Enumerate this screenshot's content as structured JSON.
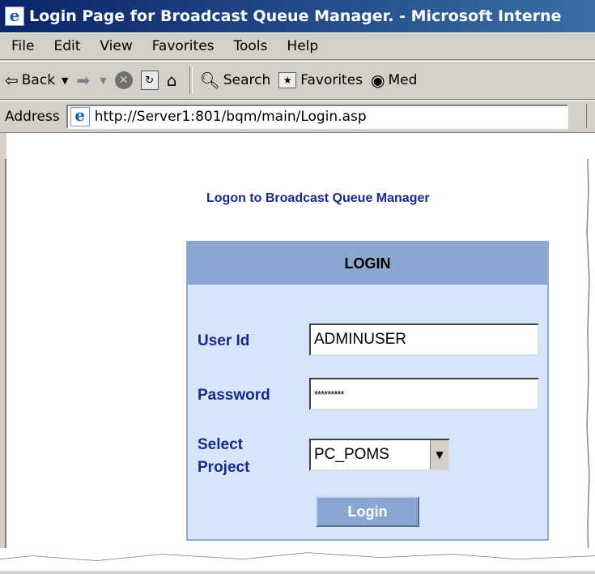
{
  "window": {
    "title": "Login Page for Broadcast Queue Manager. - Microsoft Interne"
  },
  "menu": {
    "items": [
      "File",
      "Edit",
      "View",
      "Favorites",
      "Tools",
      "Help"
    ]
  },
  "toolbar": {
    "back_label": "Back",
    "search_label": "Search",
    "favorites_label": "Favorites",
    "media_label": "Med"
  },
  "address": {
    "label": "Address",
    "url": "http://Server1:801/bqm/main/Login.asp"
  },
  "page": {
    "heading": "Logon to Broadcast Queue Manager",
    "login": {
      "header": "LOGIN",
      "user_id_label": "User Id",
      "user_id_value": "ADMINUSER",
      "password_label": "Password",
      "password_value": "*********",
      "project_label_line1": "Select",
      "project_label_line2": "Project",
      "project_value": "PC_POMS",
      "button_label": "Login"
    }
  },
  "colors": {
    "heading": "#1a2a8c",
    "box_background": "#d7e5fb",
    "box_header": "#8ca6d2"
  }
}
